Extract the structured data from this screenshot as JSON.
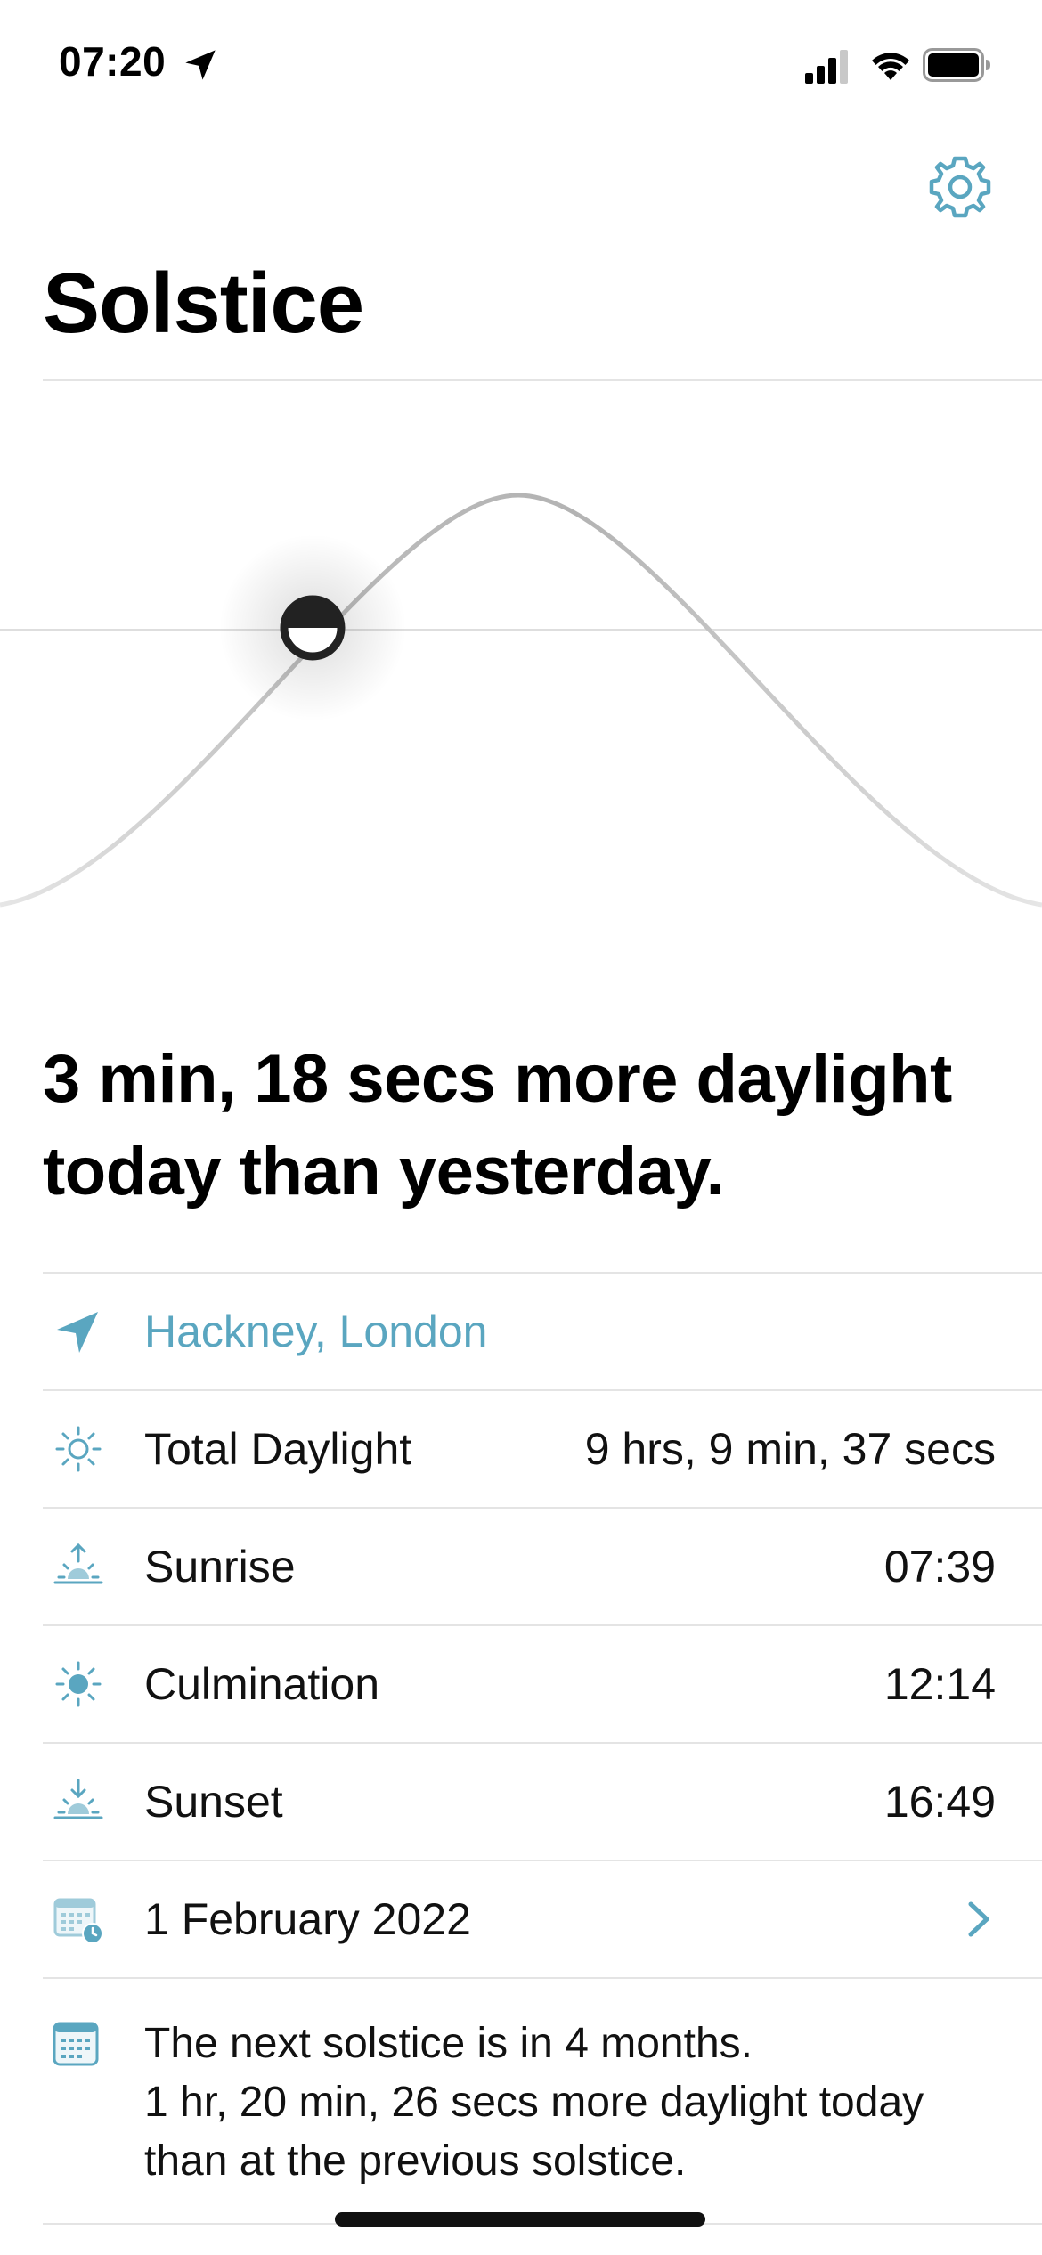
{
  "status_bar": {
    "time": "07:20",
    "location_icon": "location-arrow-icon",
    "signal_icon": "cellular-signal-icon",
    "wifi_icon": "wifi-icon",
    "battery_icon": "battery-icon"
  },
  "header": {
    "settings_icon": "gear-icon",
    "title": "Solstice"
  },
  "chart_data": {
    "type": "line",
    "description_series": "daylight-curve",
    "today_marker_icon": "half-sun-marker",
    "grid": false
  },
  "headline": {
    "line1": "3 min, 18 secs more daylight",
    "line2": "today than yesterday."
  },
  "details": {
    "location": {
      "icon": "location-arrow-icon",
      "label": "Hackney, London"
    },
    "total_daylight": {
      "icon": "sun-outline-icon",
      "label": "Total Daylight",
      "value": "9 hrs, 9 min, 37 secs"
    },
    "sunrise": {
      "icon": "sunrise-icon",
      "label": "Sunrise",
      "value": "07:39"
    },
    "culmination": {
      "icon": "sun-filled-icon",
      "label": "Culmination",
      "value": "12:14"
    },
    "sunset": {
      "icon": "sunset-icon",
      "label": "Sunset",
      "value": "16:49"
    },
    "date": {
      "icon": "calendar-clock-icon",
      "label": "1 February 2022",
      "chevron_icon": "chevron-right-icon"
    }
  },
  "solstice_note": {
    "icon": "calendar-icon",
    "line1": "The next solstice is in 4 months.",
    "line2": "1 hr, 20 min, 26 secs more daylight today",
    "line3": "than at the previous solstice."
  },
  "colors": {
    "accent": "#5aa6c0",
    "divider": "#e4e4e4",
    "text": "#111111",
    "curve": "#bdbdbd"
  }
}
